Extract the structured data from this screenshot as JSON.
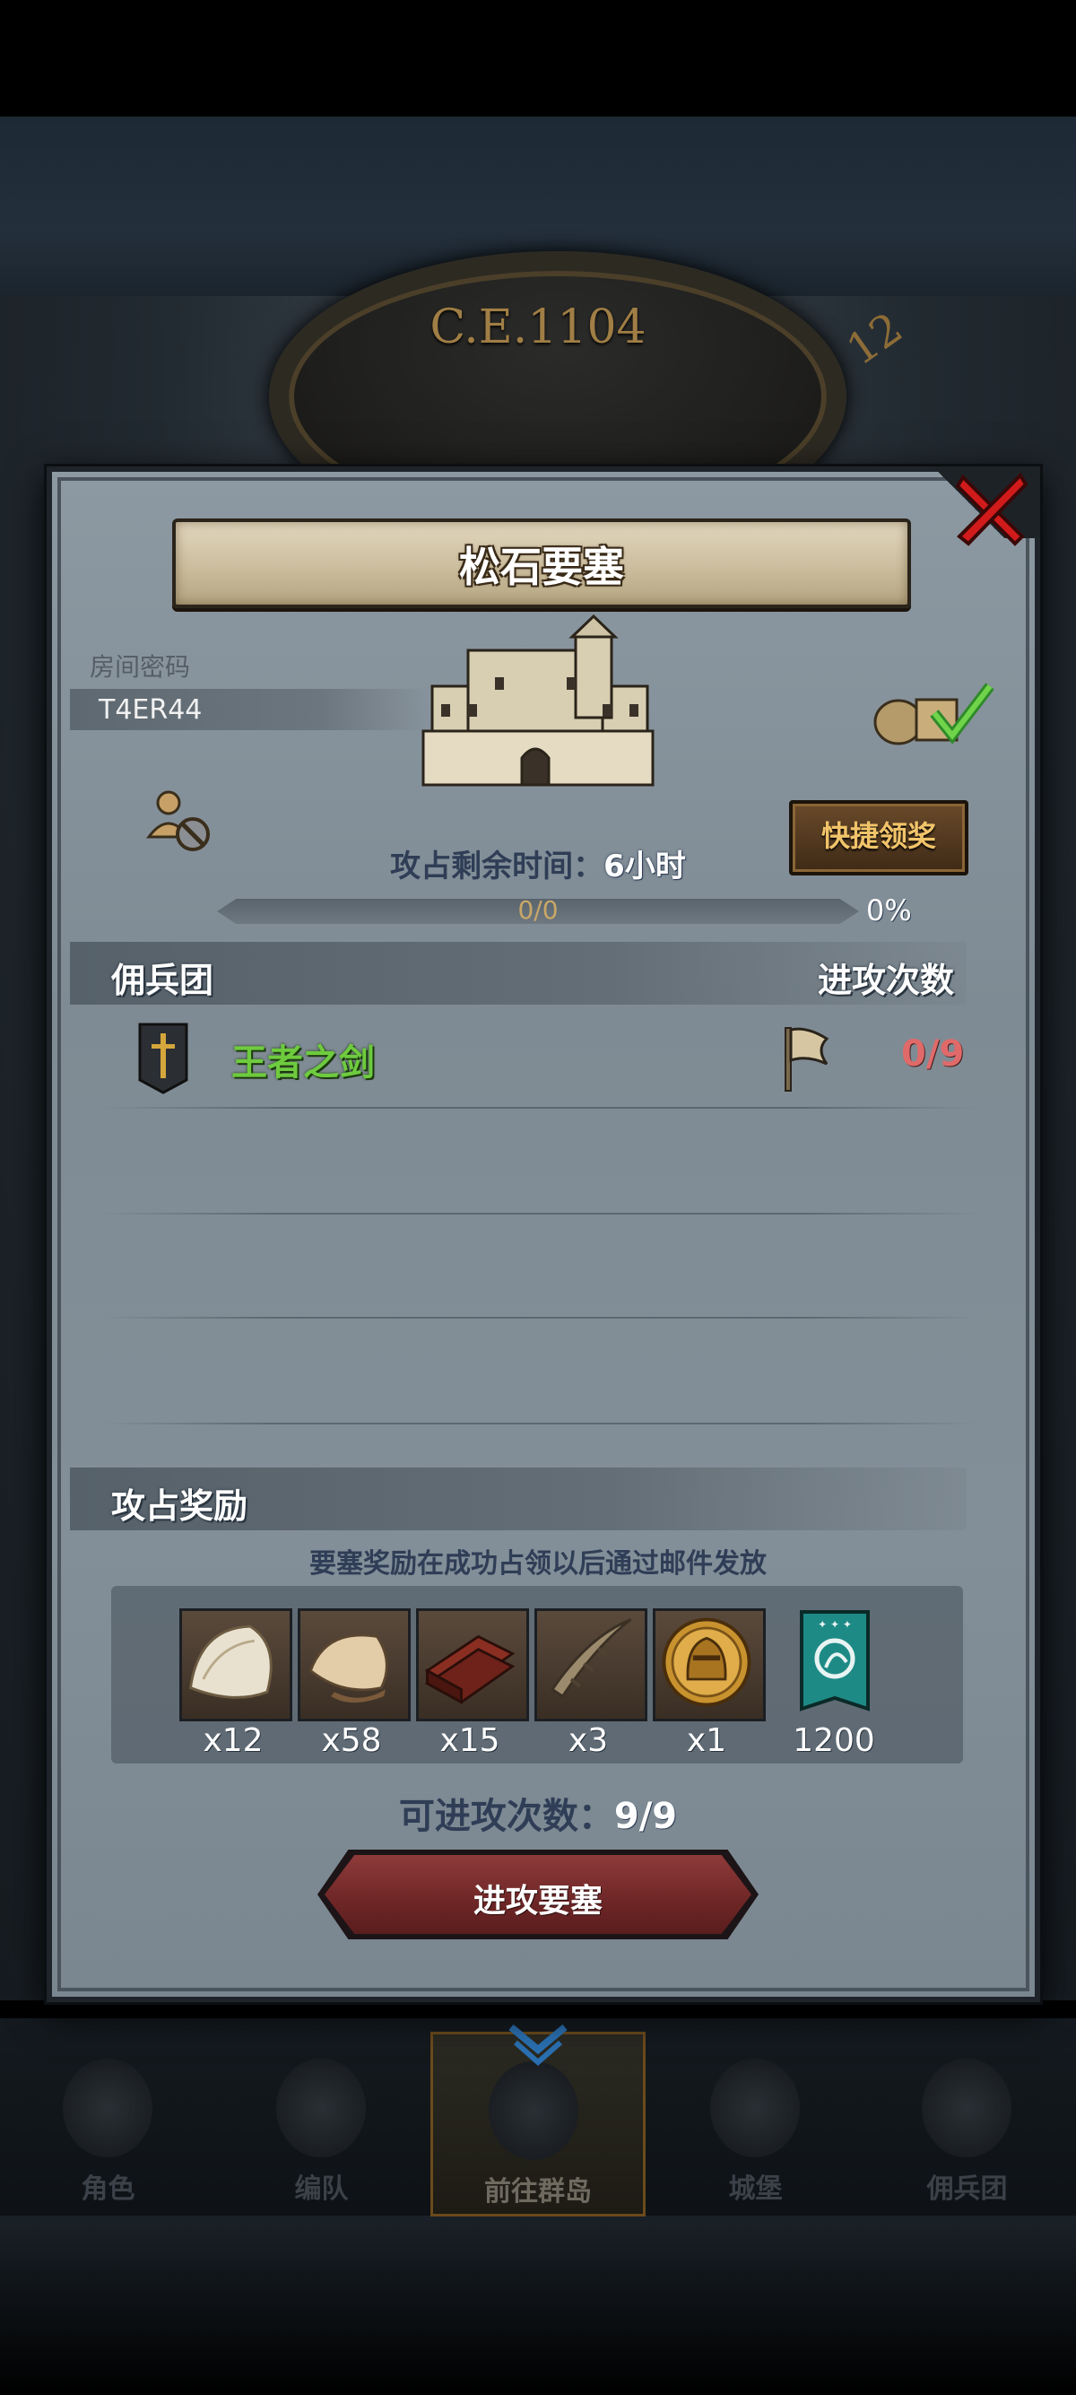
{
  "header": {
    "era": "C.E.1104",
    "dial_number": "12"
  },
  "dialog": {
    "title": "松石要塞",
    "room_code_label": "房间密码",
    "room_code": "T4ER44",
    "quick_claim_label": "快捷领奖",
    "occupy_time_label": "攻占剩余时间：",
    "occupy_time_value": "6小时",
    "progress_text": "0/0",
    "progress_percent": "0%",
    "progress_fraction": 0,
    "mercenary_header": "佣兵团",
    "attack_count_header": "进攻次数",
    "mercenaries": [
      {
        "name": "王者之剑",
        "attacks": "0/9"
      }
    ],
    "reward_header": "攻占奖励",
    "reward_note": "要塞奖励在成功占领以后通过邮件发放",
    "rewards": [
      {
        "icon": "fur-pelt-icon",
        "qty": "x12"
      },
      {
        "icon": "hide-leather-icon",
        "qty": "x58"
      },
      {
        "icon": "wood-planks-icon",
        "qty": "x15"
      },
      {
        "icon": "horn-icon",
        "qty": "x3"
      },
      {
        "icon": "knight-medal-icon",
        "qty": "x1"
      },
      {
        "icon": "guild-banner-icon",
        "qty": "1200"
      }
    ],
    "attacks_available_label": "可进攻次数：",
    "attacks_available_value": "9/9",
    "attack_button_label": "进攻要塞"
  },
  "bottom_nav": {
    "tabs": [
      {
        "label": "角色",
        "icon": "character-icon"
      },
      {
        "label": "编队",
        "icon": "formation-icon"
      },
      {
        "label": "前往群岛",
        "icon": "islands-compass-icon",
        "active": true
      },
      {
        "label": "城堡",
        "icon": "castle-nav-icon"
      },
      {
        "label": "佣兵团",
        "icon": "mercenary-ship-icon"
      }
    ]
  },
  "colors": {
    "accent_gold": "#f2c46a",
    "guild_green": "#6ecb3e",
    "attack_red": "#e06a6a",
    "button_red": "#8e3a3a",
    "close_red": "#d11b1b"
  }
}
